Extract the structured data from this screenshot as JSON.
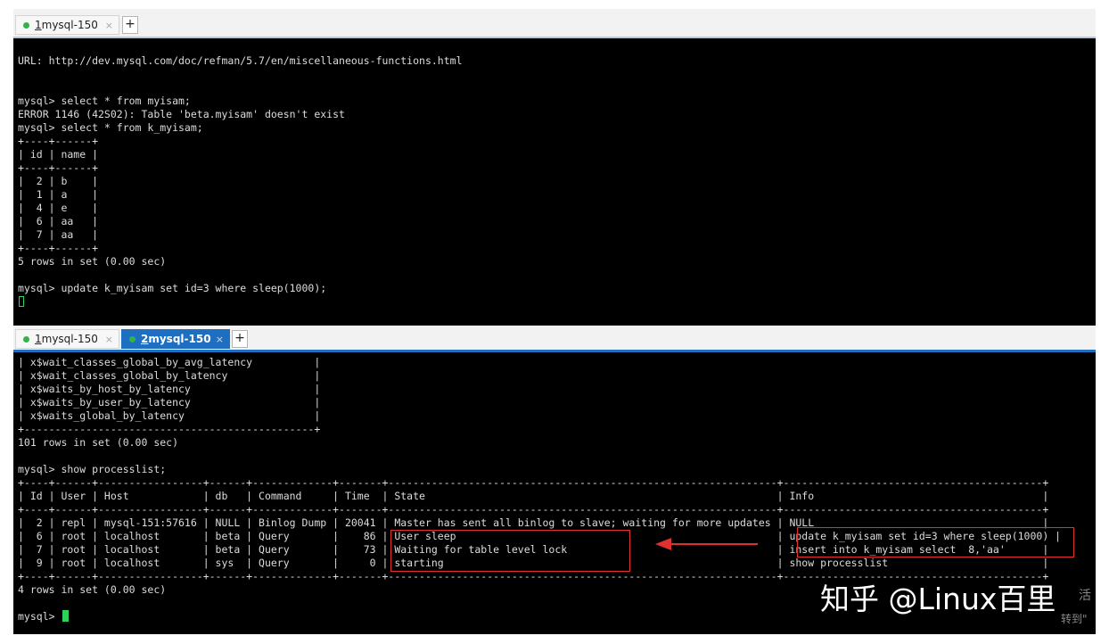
{
  "top_pane": {
    "tabs": [
      {
        "num": "1",
        "label": " mysql-150",
        "close": "×"
      }
    ],
    "new_tab": "+",
    "lines": [
      "URL: http://dev.mysql.com/doc/refman/5.7/en/miscellaneous-functions.html",
      "",
      "",
      "mysql> select * from myisam;",
      "ERROR 1146 (42S02): Table 'beta.myisam' doesn't exist",
      "mysql> select * from k_myisam;",
      "+----+------+",
      "| id | name |",
      "+----+------+",
      "|  2 | b    |",
      "|  1 | a    |",
      "|  4 | e    |",
      "|  6 | aa   |",
      "|  7 | aa   |",
      "+----+------+",
      "5 rows in set (0.00 sec)",
      "",
      "mysql> update k_myisam set id=3 where sleep(1000);"
    ]
  },
  "bottom_pane": {
    "tabs": [
      {
        "num": "1",
        "label": " mysql-150",
        "close": "×"
      },
      {
        "num": "2",
        "label": " mysql-150",
        "close": "×"
      }
    ],
    "new_tab": "+",
    "lines": [
      "| x$wait_classes_global_by_avg_latency          |",
      "| x$wait_classes_global_by_latency              |",
      "| x$waits_by_host_by_latency                    |",
      "| x$waits_by_user_by_latency                    |",
      "| x$waits_global_by_latency                     |",
      "+-----------------------------------------------+",
      "101 rows in set (0.00 sec)",
      "",
      "mysql> show processlist;",
      "+----+------+-----------------+------+-------------+-------+---------------------------------------------------------------+------------------------------------------+",
      "| Id | User | Host            | db   | Command     | Time  | State                                                         | Info                                     |",
      "+----+------+-----------------+------+-------------+-------+---------------------------------------------------------------+------------------------------------------+",
      "|  2 | repl | mysql-151:57616 | NULL | Binlog Dump | 20041 | Master has sent all binlog to slave; waiting for more updates | NULL                                     |",
      "|  6 | root | localhost       | beta | Query       |    86 | User sleep                                                    | update k_myisam set id=3 where sleep(1000) |",
      "|  7 | root | localhost       | beta | Query       |    73 | Waiting for table level lock                                  | insert into k_myisam select  8,'aa'      |",
      "|  9 | root | localhost       | sys  | Query       |     0 | starting                                                      | show processlist                         |",
      "+----+------+-----------------+------+-------------+-------+---------------------------------------------------------------+------------------------------------------+",
      "4 rows in set (0.00 sec)",
      "",
      "mysql> "
    ]
  },
  "watermark": {
    "main": "知乎 @Linux百里",
    "side1": "活",
    "side2": "转到\""
  },
  "colors": {
    "terminal_bg": "#000000",
    "terminal_fg": "#dcdcdc",
    "cursor": "#2fd35a",
    "highlight": "#e03030",
    "active_tab": "#1e6fc2"
  }
}
